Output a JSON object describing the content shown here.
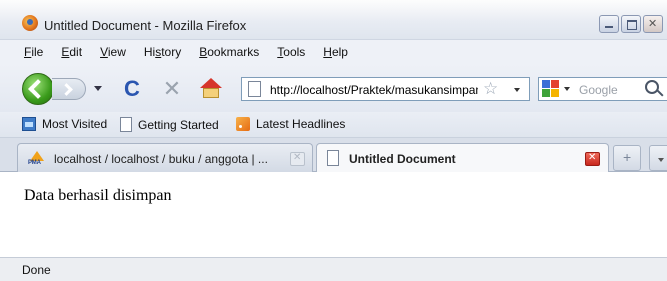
{
  "window": {
    "title": "Untitled Document - Mozilla Firefox"
  },
  "menu": [
    {
      "pre": "",
      "key": "F",
      "post": "ile"
    },
    {
      "pre": "",
      "key": "E",
      "post": "dit"
    },
    {
      "pre": "",
      "key": "V",
      "post": "iew"
    },
    {
      "pre": "Hi",
      "key": "s",
      "post": "tory"
    },
    {
      "pre": "",
      "key": "B",
      "post": "ookmarks"
    },
    {
      "pre": "",
      "key": "T",
      "post": "ools"
    },
    {
      "pre": "",
      "key": "H",
      "post": "elp"
    }
  ],
  "navigation": {
    "url": "http://localhost/Praktek/masukansimpan.php",
    "search_placeholder": "Google",
    "icons": [
      "back-icon",
      "forward-icon",
      "history-dropdown-icon",
      "reload-icon",
      "stop-icon",
      "home-icon",
      "bookmark-star-icon",
      "search-engine-icon",
      "search-icon"
    ]
  },
  "bookmarks": [
    {
      "label": "Most Visited",
      "icon": "most-visited-icon"
    },
    {
      "label": "Getting Started",
      "icon": "page-icon"
    },
    {
      "label": "Latest Headlines",
      "icon": "rss-feed-icon"
    }
  ],
  "tabs": [
    {
      "label": "localhost / localhost / buku / anggota | ...",
      "active": false,
      "icon": "phpmyadmin-icon",
      "icon_text": "PMA"
    },
    {
      "label": "Untitled Document",
      "active": true,
      "icon": "page-icon"
    }
  ],
  "page": {
    "message": "Data berhasil disimpan"
  },
  "status": {
    "text": "Done"
  },
  "colors": {
    "chrome": "#dfe5ee",
    "back_button": "#3a9b1b",
    "close_tab": "#c8281e",
    "link_blue": "#2b56b0"
  }
}
